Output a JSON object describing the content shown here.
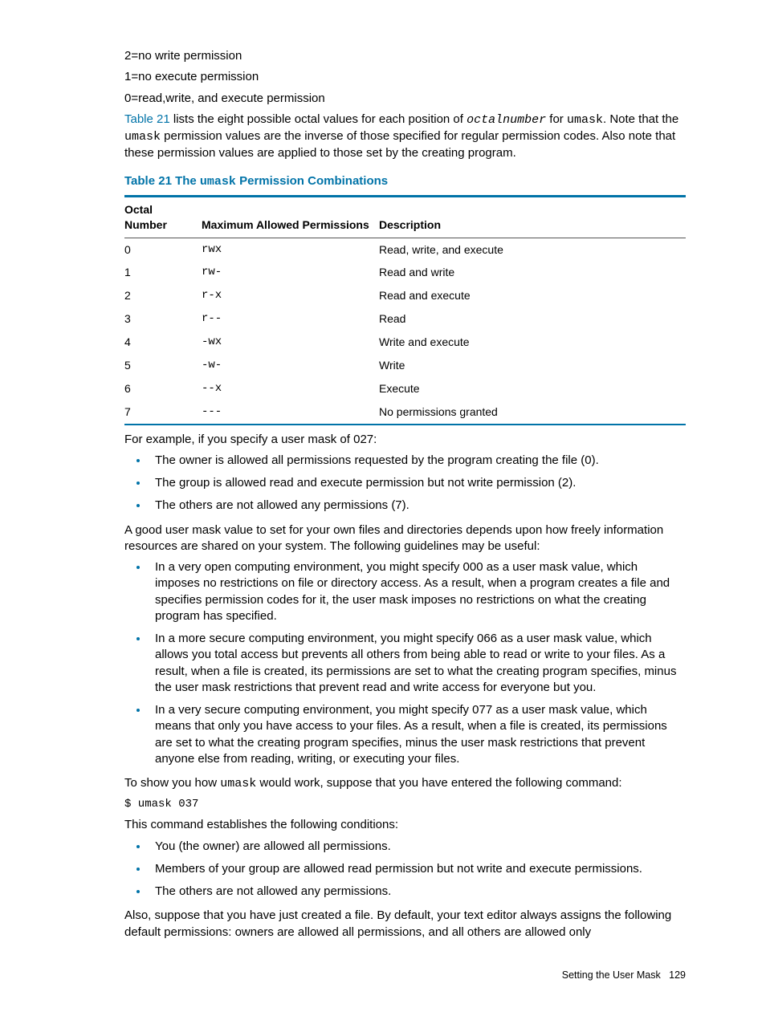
{
  "perms": {
    "p2": "2=no write permission",
    "p1": "1=no execute permission",
    "p0": "0=read,write, and execute permission"
  },
  "intro": {
    "linktext": "Table 21",
    "part1": " lists the eight possible octal values for each position of ",
    "octal": "octalnumber",
    "part2": " for ",
    "umask": "umask",
    "part3": ". Note that the ",
    "part4": " permission values are the inverse of those specified for regular permission codes. Also note that these permission values are applied to those set by the creating program."
  },
  "tablecaption": {
    "pre": "Table 21 The ",
    "code": "umask",
    "post": " Permission Combinations"
  },
  "headers": {
    "h1a": "Octal",
    "h1b": "Number",
    "h2": "Maximum Allowed Permissions",
    "h3": "Description"
  },
  "rows": [
    {
      "n": "0",
      "p": "rwx",
      "d": "Read, write, and execute"
    },
    {
      "n": "1",
      "p": "rw-",
      "d": "Read and write"
    },
    {
      "n": "2",
      "p": "r-x",
      "d": "Read and execute"
    },
    {
      "n": "3",
      "p": "r--",
      "d": "Read"
    },
    {
      "n": "4",
      "p": "-wx",
      "d": "Write and execute"
    },
    {
      "n": "5",
      "p": "-w-",
      "d": "Write"
    },
    {
      "n": "6",
      "p": "--x",
      "d": "Execute"
    },
    {
      "n": "7",
      "p": "---",
      "d": "No permissions granted"
    }
  ],
  "example_intro": "For example, if you specify a user mask of 027:",
  "example_list": [
    "The owner is allowed all permissions requested by the program creating the file (0).",
    "The group is allowed read and execute permission but not write permission (2).",
    "The others are not allowed any permissions (7)."
  ],
  "guideline_intro": "A good user mask value to set for your own files and directories depends upon how freely information resources are shared on your system. The following guidelines may be useful:",
  "guideline_list": [
    "In a very open computing environment, you might specify 000 as a user mask value, which imposes no restrictions on file or directory access. As a result, when a program creates a file and specifies permission codes for it, the user mask imposes no restrictions on what the creating program has specified.",
    "In a more secure computing environment, you might specify 066 as a user mask value, which allows you total access but prevents all others from being able to read or write to your files. As a result, when a file is created, its permissions are set to what the creating program specifies, minus the user mask restrictions that prevent read and write access for everyone but you.",
    "In a very secure computing environment, you might specify 077 as a user mask value, which means that only you have access to your files. As a result, when a file is created, its permissions are set to what the creating program specifies, minus the user mask restrictions that prevent anyone else from reading, writing, or executing your files."
  ],
  "show": {
    "a": "To show you how ",
    "code": "umask",
    "b": " would work, suppose that you have entered the following command:"
  },
  "cmd": "$ umask 037",
  "conditions_intro": "This command establishes the following conditions:",
  "conditions_list": [
    "You (the owner) are allowed all permissions.",
    "Members of your group are allowed read permission but not write and execute permissions.",
    "The others are not allowed any permissions."
  ],
  "closing": "Also, suppose that you have just created a file. By default, your text editor always assigns the following default permissions: owners are allowed all permissions, and all others are allowed only",
  "footer": {
    "section": "Setting the User Mask",
    "page": "129"
  }
}
